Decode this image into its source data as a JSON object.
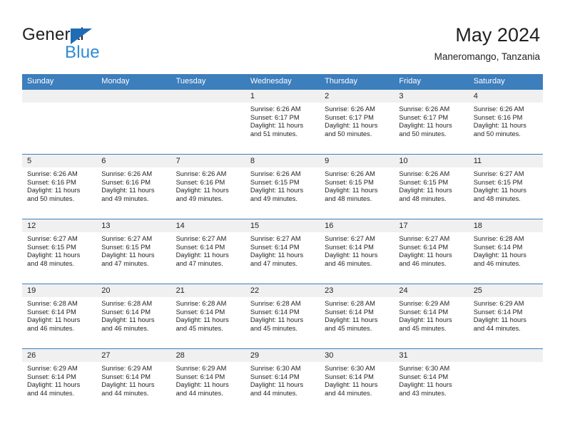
{
  "brand": {
    "name_part1": "General",
    "name_part2": "Blue",
    "flag_icon": "triangle-flag-icon",
    "accent_color": "#1e6cb5",
    "accent_color_light": "#2e8ad4"
  },
  "header": {
    "title": "May 2024",
    "subtitle": "Maneromango, Tanzania"
  },
  "calendar": {
    "header_bg": "#3d7ebc",
    "daynum_bg": "#f0f0f0",
    "weekdays": [
      "Sunday",
      "Monday",
      "Tuesday",
      "Wednesday",
      "Thursday",
      "Friday",
      "Saturday"
    ],
    "weeks": [
      {
        "days": [
          {
            "num": "",
            "l1": "",
            "l2": "",
            "l3": "",
            "l4": ""
          },
          {
            "num": "",
            "l1": "",
            "l2": "",
            "l3": "",
            "l4": ""
          },
          {
            "num": "",
            "l1": "",
            "l2": "",
            "l3": "",
            "l4": ""
          },
          {
            "num": "1",
            "l1": "Sunrise: 6:26 AM",
            "l2": "Sunset: 6:17 PM",
            "l3": "Daylight: 11 hours",
            "l4": "and 51 minutes."
          },
          {
            "num": "2",
            "l1": "Sunrise: 6:26 AM",
            "l2": "Sunset: 6:17 PM",
            "l3": "Daylight: 11 hours",
            "l4": "and 50 minutes."
          },
          {
            "num": "3",
            "l1": "Sunrise: 6:26 AM",
            "l2": "Sunset: 6:17 PM",
            "l3": "Daylight: 11 hours",
            "l4": "and 50 minutes."
          },
          {
            "num": "4",
            "l1": "Sunrise: 6:26 AM",
            "l2": "Sunset: 6:16 PM",
            "l3": "Daylight: 11 hours",
            "l4": "and 50 minutes."
          }
        ]
      },
      {
        "days": [
          {
            "num": "5",
            "l1": "Sunrise: 6:26 AM",
            "l2": "Sunset: 6:16 PM",
            "l3": "Daylight: 11 hours",
            "l4": "and 50 minutes."
          },
          {
            "num": "6",
            "l1": "Sunrise: 6:26 AM",
            "l2": "Sunset: 6:16 PM",
            "l3": "Daylight: 11 hours",
            "l4": "and 49 minutes."
          },
          {
            "num": "7",
            "l1": "Sunrise: 6:26 AM",
            "l2": "Sunset: 6:16 PM",
            "l3": "Daylight: 11 hours",
            "l4": "and 49 minutes."
          },
          {
            "num": "8",
            "l1": "Sunrise: 6:26 AM",
            "l2": "Sunset: 6:15 PM",
            "l3": "Daylight: 11 hours",
            "l4": "and 49 minutes."
          },
          {
            "num": "9",
            "l1": "Sunrise: 6:26 AM",
            "l2": "Sunset: 6:15 PM",
            "l3": "Daylight: 11 hours",
            "l4": "and 48 minutes."
          },
          {
            "num": "10",
            "l1": "Sunrise: 6:26 AM",
            "l2": "Sunset: 6:15 PM",
            "l3": "Daylight: 11 hours",
            "l4": "and 48 minutes."
          },
          {
            "num": "11",
            "l1": "Sunrise: 6:27 AM",
            "l2": "Sunset: 6:15 PM",
            "l3": "Daylight: 11 hours",
            "l4": "and 48 minutes."
          }
        ]
      },
      {
        "days": [
          {
            "num": "12",
            "l1": "Sunrise: 6:27 AM",
            "l2": "Sunset: 6:15 PM",
            "l3": "Daylight: 11 hours",
            "l4": "and 48 minutes."
          },
          {
            "num": "13",
            "l1": "Sunrise: 6:27 AM",
            "l2": "Sunset: 6:15 PM",
            "l3": "Daylight: 11 hours",
            "l4": "and 47 minutes."
          },
          {
            "num": "14",
            "l1": "Sunrise: 6:27 AM",
            "l2": "Sunset: 6:14 PM",
            "l3": "Daylight: 11 hours",
            "l4": "and 47 minutes."
          },
          {
            "num": "15",
            "l1": "Sunrise: 6:27 AM",
            "l2": "Sunset: 6:14 PM",
            "l3": "Daylight: 11 hours",
            "l4": "and 47 minutes."
          },
          {
            "num": "16",
            "l1": "Sunrise: 6:27 AM",
            "l2": "Sunset: 6:14 PM",
            "l3": "Daylight: 11 hours",
            "l4": "and 46 minutes."
          },
          {
            "num": "17",
            "l1": "Sunrise: 6:27 AM",
            "l2": "Sunset: 6:14 PM",
            "l3": "Daylight: 11 hours",
            "l4": "and 46 minutes."
          },
          {
            "num": "18",
            "l1": "Sunrise: 6:28 AM",
            "l2": "Sunset: 6:14 PM",
            "l3": "Daylight: 11 hours",
            "l4": "and 46 minutes."
          }
        ]
      },
      {
        "days": [
          {
            "num": "19",
            "l1": "Sunrise: 6:28 AM",
            "l2": "Sunset: 6:14 PM",
            "l3": "Daylight: 11 hours",
            "l4": "and 46 minutes."
          },
          {
            "num": "20",
            "l1": "Sunrise: 6:28 AM",
            "l2": "Sunset: 6:14 PM",
            "l3": "Daylight: 11 hours",
            "l4": "and 46 minutes."
          },
          {
            "num": "21",
            "l1": "Sunrise: 6:28 AM",
            "l2": "Sunset: 6:14 PM",
            "l3": "Daylight: 11 hours",
            "l4": "and 45 minutes."
          },
          {
            "num": "22",
            "l1": "Sunrise: 6:28 AM",
            "l2": "Sunset: 6:14 PM",
            "l3": "Daylight: 11 hours",
            "l4": "and 45 minutes."
          },
          {
            "num": "23",
            "l1": "Sunrise: 6:28 AM",
            "l2": "Sunset: 6:14 PM",
            "l3": "Daylight: 11 hours",
            "l4": "and 45 minutes."
          },
          {
            "num": "24",
            "l1": "Sunrise: 6:29 AM",
            "l2": "Sunset: 6:14 PM",
            "l3": "Daylight: 11 hours",
            "l4": "and 45 minutes."
          },
          {
            "num": "25",
            "l1": "Sunrise: 6:29 AM",
            "l2": "Sunset: 6:14 PM",
            "l3": "Daylight: 11 hours",
            "l4": "and 44 minutes."
          }
        ]
      },
      {
        "days": [
          {
            "num": "26",
            "l1": "Sunrise: 6:29 AM",
            "l2": "Sunset: 6:14 PM",
            "l3": "Daylight: 11 hours",
            "l4": "and 44 minutes."
          },
          {
            "num": "27",
            "l1": "Sunrise: 6:29 AM",
            "l2": "Sunset: 6:14 PM",
            "l3": "Daylight: 11 hours",
            "l4": "and 44 minutes."
          },
          {
            "num": "28",
            "l1": "Sunrise: 6:29 AM",
            "l2": "Sunset: 6:14 PM",
            "l3": "Daylight: 11 hours",
            "l4": "and 44 minutes."
          },
          {
            "num": "29",
            "l1": "Sunrise: 6:30 AM",
            "l2": "Sunset: 6:14 PM",
            "l3": "Daylight: 11 hours",
            "l4": "and 44 minutes."
          },
          {
            "num": "30",
            "l1": "Sunrise: 6:30 AM",
            "l2": "Sunset: 6:14 PM",
            "l3": "Daylight: 11 hours",
            "l4": "and 44 minutes."
          },
          {
            "num": "31",
            "l1": "Sunrise: 6:30 AM",
            "l2": "Sunset: 6:14 PM",
            "l3": "Daylight: 11 hours",
            "l4": "and 43 minutes."
          },
          {
            "num": "",
            "l1": "",
            "l2": "",
            "l3": "",
            "l4": ""
          }
        ]
      }
    ]
  }
}
